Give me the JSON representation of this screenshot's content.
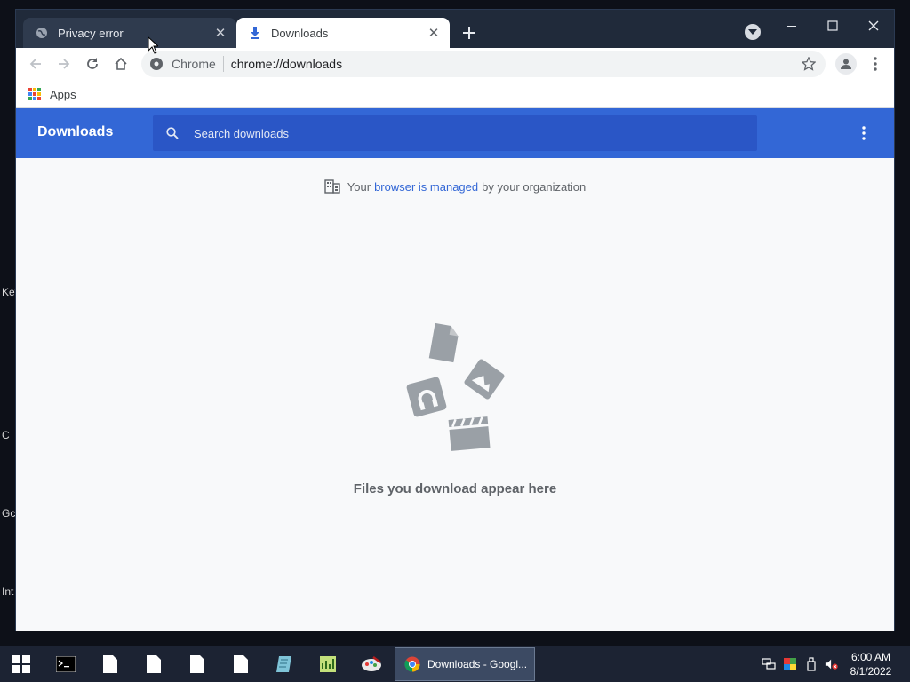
{
  "desktop": {
    "labels": [
      "Key",
      "C",
      "Gc",
      "Int"
    ]
  },
  "tabs": [
    {
      "title": "Privacy error",
      "active": false
    },
    {
      "title": "Downloads",
      "active": true
    }
  ],
  "toolbar": {
    "origin": "Chrome",
    "url": "chrome://downloads"
  },
  "bookmarks": {
    "apps_label": "Apps"
  },
  "downloads_page": {
    "title": "Downloads",
    "search_placeholder": "Search downloads",
    "managed_prefix": "Your",
    "managed_link": "browser is managed",
    "managed_suffix": "by your organization",
    "empty_message": "Files you download appear here"
  },
  "taskbar": {
    "active_app_label": "Downloads - Googl...",
    "time": "6:00 AM",
    "date": "8/1/2022"
  },
  "colors": {
    "header_blue": "#3367d6",
    "search_blue": "#2a56c6",
    "titlebar": "#202a3a",
    "illustration_gray": "#9aa0a6"
  }
}
